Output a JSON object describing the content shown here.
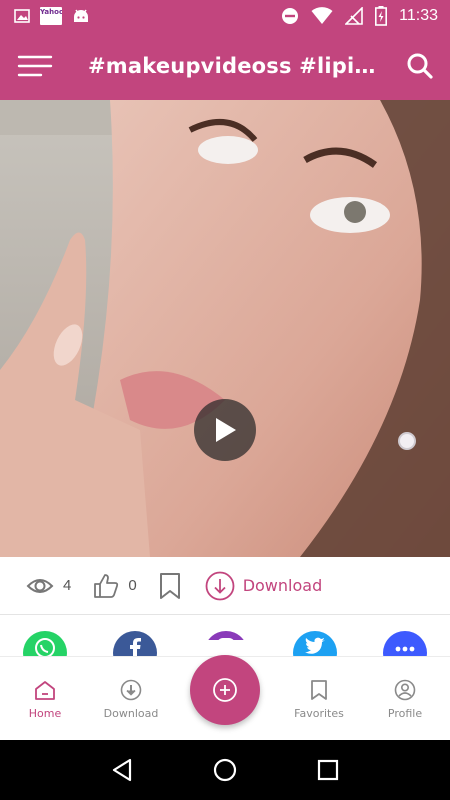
{
  "status_bar": {
    "time": "11:33",
    "left_icons": [
      "image-icon",
      "yahoo-app-icon",
      "android-debug-icon"
    ],
    "right_icons": [
      "do-not-disturb-icon",
      "wifi-icon",
      "no-signal-icon",
      "battery-charging-icon"
    ],
    "yahoo_badge_text": "Yahoo"
  },
  "app_bar": {
    "title": "#makeupvideoss #lipinjectionsthebest",
    "menu_icon": "hamburger-menu-icon",
    "search_icon": "search-icon"
  },
  "video": {
    "play_icon": "play-icon"
  },
  "actions": {
    "views_count": "4",
    "likes_count": "0",
    "download_label": "Download"
  },
  "share": {
    "items": [
      "whatsapp",
      "facebook",
      "instagram",
      "twitter",
      "more"
    ]
  },
  "bottom_nav": {
    "items": [
      {
        "label": "Home",
        "icon": "home-icon",
        "active": true
      },
      {
        "label": "Download",
        "icon": "download-icon",
        "active": false
      },
      {
        "label": "Favorites",
        "icon": "bookmark-icon",
        "active": false
      },
      {
        "label": "Profile",
        "icon": "profile-icon",
        "active": false
      }
    ],
    "fab_icon": "add-circle-icon"
  },
  "colors": {
    "brand": "#c2457e",
    "whatsapp": "#25d366",
    "facebook": "#3b5998",
    "instagram": "#8a3ab9",
    "twitter": "#1da1f2",
    "more": "#3d5afe"
  }
}
